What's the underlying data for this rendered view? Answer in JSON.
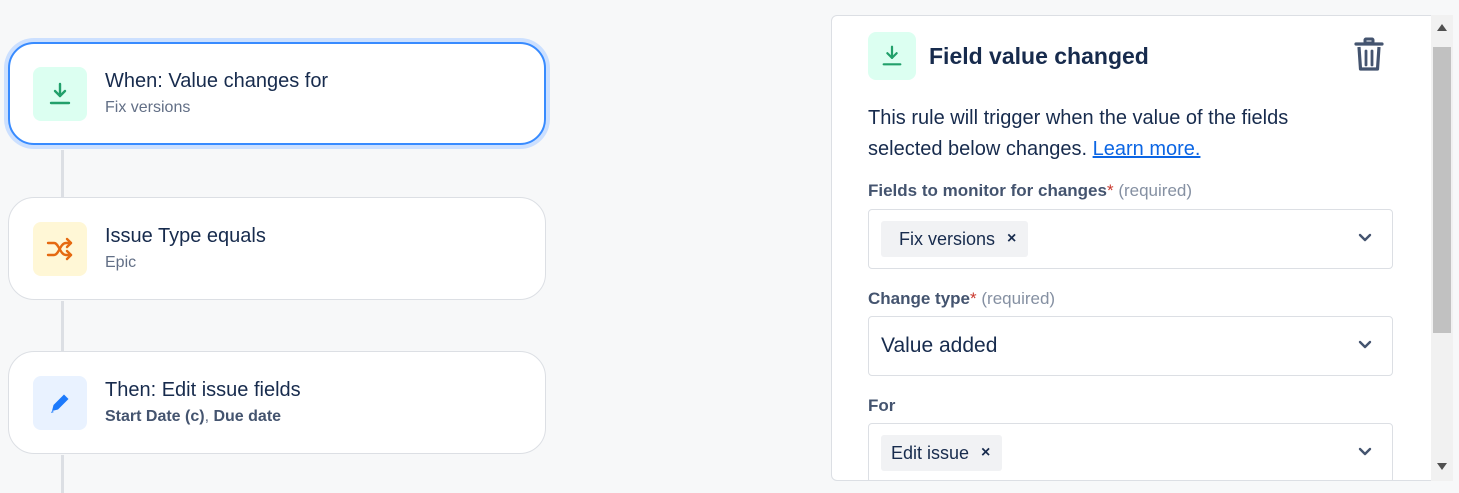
{
  "flow": {
    "cards": [
      {
        "title": "When: Value changes for",
        "subtitle": "Fix versions",
        "icon": "field-change-trigger-icon",
        "color": "#dcfff1",
        "selected": true
      },
      {
        "title": "Issue Type equals",
        "subtitle": "Epic",
        "icon": "shuffle-condition-icon",
        "color": "#fff7d6"
      },
      {
        "title": "Then: Edit issue fields",
        "subtitle_bold_1": "Start Date (c)",
        "subtitle_sep": ", ",
        "subtitle_bold_2": "Due date",
        "icon": "pencil-icon",
        "color": "#e9f2ff"
      }
    ]
  },
  "panel": {
    "title": "Field value changed",
    "description": "This rule will trigger when the value of the fields selected below changes.",
    "learn_more": "Learn more.",
    "fields": {
      "monitor_label": "Fields to monitor for changes",
      "monitor_chip": "Fix versions",
      "change_type_label": "Change type",
      "change_type_value": "Value added",
      "for_label": "For",
      "for_chip": "Edit issue"
    },
    "required_mark": "*",
    "required_hint": "(required)",
    "chip_remove": "×"
  },
  "colors": {
    "accent": "#388bff",
    "green_icon": "#22a06b",
    "orange_icon": "#e56910",
    "blue_icon": "#1d7afc",
    "link": "#0c66e4"
  }
}
